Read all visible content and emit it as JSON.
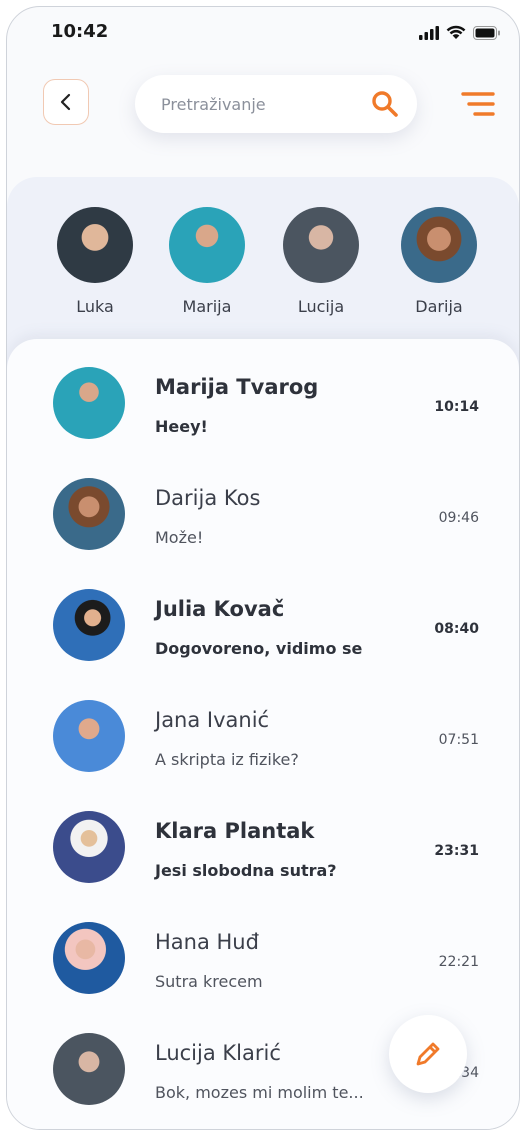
{
  "status_bar": {
    "time": "10:42"
  },
  "header": {
    "search_placeholder": "Pretraživanje"
  },
  "colors": {
    "accent": "#f07a2a"
  },
  "stories": [
    {
      "name": "Luka",
      "avatar_color": "#3a4a5a"
    },
    {
      "name": "Marija",
      "avatar_color": "#2aa3b8"
    },
    {
      "name": "Lucija",
      "avatar_color": "#4b5560"
    },
    {
      "name": "Darija",
      "avatar_color": "#3a6a8a"
    }
  ],
  "chats": [
    {
      "name": "Marija Tvarog",
      "message": "Heey!",
      "time": "10:14",
      "unread": true,
      "avatar_color": "#2aa3b8"
    },
    {
      "name": "Darija Kos",
      "message": "Može!",
      "time": "09:46",
      "unread": false,
      "avatar_color": "#3a6a8a"
    },
    {
      "name": "Julia Kovač",
      "message": "Dogovoreno, vidimo se",
      "time": "08:40",
      "unread": true,
      "avatar_color": "#2f6fb8"
    },
    {
      "name": "Jana Ivanić",
      "message": "A skripta iz fizike?",
      "time": "07:51",
      "unread": false,
      "avatar_color": "#4a8ad8"
    },
    {
      "name": "Klara Plantak",
      "message": "Jesi slobodna sutra?",
      "time": "23:31",
      "unread": true,
      "avatar_color": "#3b4c8c"
    },
    {
      "name": "Hana Huđ",
      "message": "Sutra krecem",
      "time": "22:21",
      "unread": false,
      "avatar_color": "#1f5aa0"
    },
    {
      "name": "Lucija Klarić",
      "message": "Bok, mozes mi molim te...",
      "time": "21:34",
      "unread": false,
      "avatar_color": "#4b5560"
    }
  ]
}
